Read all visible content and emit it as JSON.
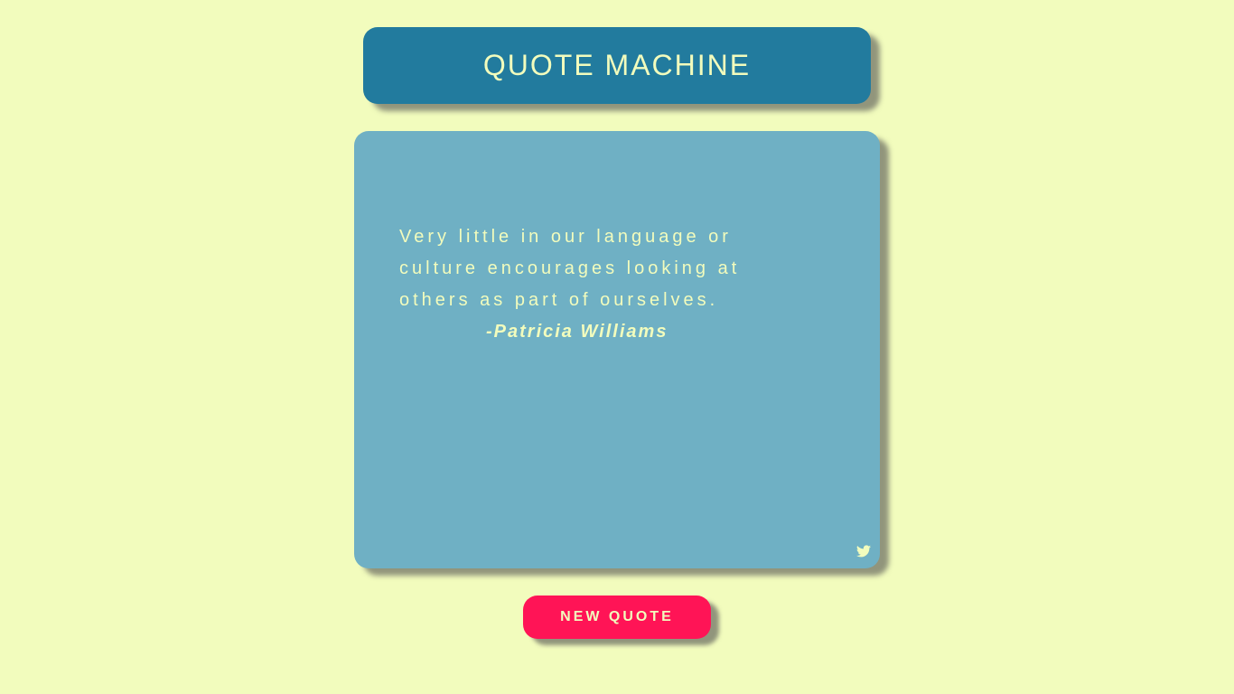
{
  "header": {
    "title": "QUOTE MACHINE"
  },
  "quote": {
    "text": "Very little in our language or culture encourages looking at others as part of ourselves.",
    "author": "-Patricia Williams"
  },
  "icons": {
    "tweet": "twitter-bird-icon"
  },
  "actions": {
    "new_quote_label": "NEW QUOTE"
  },
  "colors": {
    "background": "#f2fcbd",
    "header_bg": "#227b9e",
    "card_bg": "#6fb0c4",
    "accent_text": "#f2fcbd",
    "button_bg": "#ff1456"
  }
}
